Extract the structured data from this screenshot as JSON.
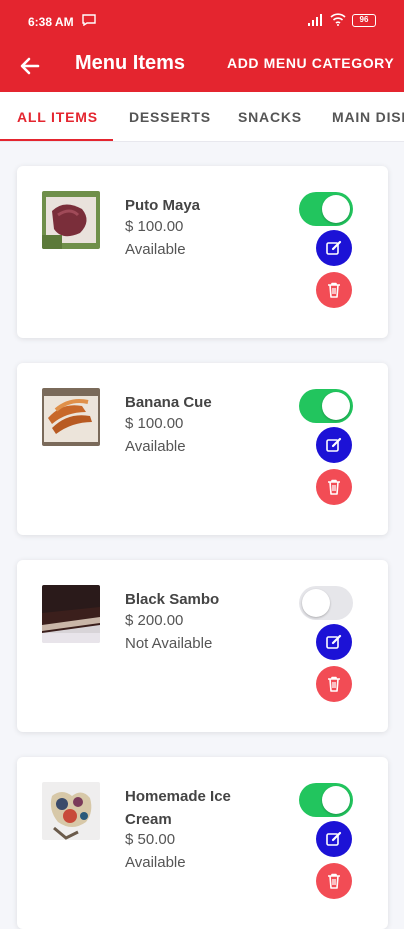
{
  "statusbar": {
    "time": "6:38 AM",
    "battery": "96"
  },
  "appbar": {
    "title": "Menu Items",
    "action": "ADD MENU CATEGORY"
  },
  "tabs": [
    {
      "label": "ALL ITEMS",
      "active": true
    },
    {
      "label": "DESSERTS",
      "active": false
    },
    {
      "label": "SNACKS",
      "active": false
    },
    {
      "label": "MAIN DISHES",
      "active": false
    }
  ],
  "items": [
    {
      "name": "Puto Maya",
      "price": "$ 100.00",
      "status": "Available",
      "available": true,
      "icon": "puto-maya-photo"
    },
    {
      "name": "Banana Cue",
      "price": "$ 100.00",
      "status": "Available",
      "available": true,
      "icon": "banana-cue-photo"
    },
    {
      "name": "Black Sambo",
      "price": "$ 200.00",
      "status": "Not Available",
      "available": false,
      "icon": "black-sambo-photo"
    },
    {
      "name": "Homemade Ice Cream",
      "price": "$ 50.00",
      "status": "Available",
      "available": true,
      "icon": "ice-cream-photo"
    }
  ],
  "colors": {
    "brand": "#e4252f",
    "toggle_on": "#22c55e",
    "edit": "#1c12d6",
    "delete": "#f24c55"
  }
}
